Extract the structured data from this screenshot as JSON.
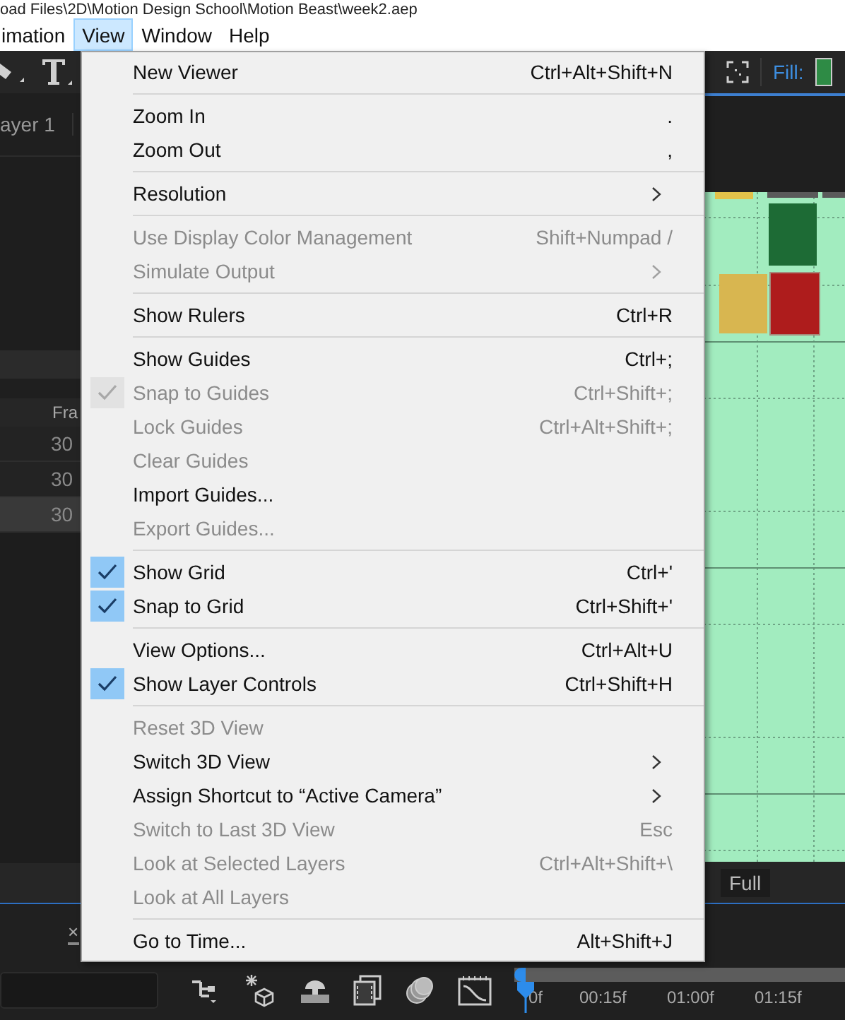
{
  "window": {
    "title": "oad Files\\2D\\Motion Design School\\Motion Beast\\week2.aep"
  },
  "menubar": [
    {
      "label": "imation",
      "selected": false
    },
    {
      "label": "View",
      "selected": true
    },
    {
      "label": "Window",
      "selected": false
    },
    {
      "label": "Help",
      "selected": false
    }
  ],
  "left_panel": {
    "tab": "ayer 1",
    "column_header": "Fra",
    "rows": [
      {
        "value": "30",
        "selected": false
      },
      {
        "value": "30",
        "selected": false
      },
      {
        "value": "30",
        "selected": true
      }
    ]
  },
  "viewer": {
    "fill_label": "Fill:",
    "resolution": "Full"
  },
  "timeline": {
    "close": "×",
    "ticks": [
      "0f",
      "00:15f",
      "01:00f",
      "01:15f"
    ]
  },
  "view_menu": {
    "groups": [
      [
        {
          "label": "New Viewer",
          "shortcut": "Ctrl+Alt+Shift+N",
          "disabled": false,
          "checked": false,
          "submenu": false
        }
      ],
      [
        {
          "label": "Zoom In",
          "shortcut": ".",
          "disabled": false,
          "checked": false,
          "submenu": false
        },
        {
          "label": "Zoom Out",
          "shortcut": ",",
          "disabled": false,
          "checked": false,
          "submenu": false
        }
      ],
      [
        {
          "label": "Resolution",
          "disabled": false,
          "checked": false,
          "submenu": true
        }
      ],
      [
        {
          "label": "Use Display Color Management",
          "shortcut": "Shift+Numpad /",
          "disabled": true,
          "checked": false,
          "submenu": false
        },
        {
          "label": "Simulate Output",
          "disabled": true,
          "checked": false,
          "submenu": true
        }
      ],
      [
        {
          "label": "Show Rulers",
          "shortcut": "Ctrl+R",
          "disabled": false,
          "checked": false,
          "submenu": false
        }
      ],
      [
        {
          "label": "Show Guides",
          "shortcut": "Ctrl+;",
          "disabled": false,
          "checked": false,
          "submenu": false
        },
        {
          "label": "Snap to Guides",
          "shortcut": "Ctrl+Shift+;",
          "disabled": true,
          "checked": true,
          "submenu": false
        },
        {
          "label": "Lock Guides",
          "shortcut": "Ctrl+Alt+Shift+;",
          "disabled": true,
          "checked": false,
          "submenu": false
        },
        {
          "label": "Clear Guides",
          "disabled": true,
          "checked": false,
          "submenu": false
        },
        {
          "label": "Import Guides...",
          "disabled": false,
          "checked": false,
          "submenu": false
        },
        {
          "label": "Export Guides...",
          "disabled": true,
          "checked": false,
          "submenu": false
        }
      ],
      [
        {
          "label": "Show Grid",
          "shortcut": "Ctrl+'",
          "disabled": false,
          "checked": true,
          "submenu": false
        },
        {
          "label": "Snap to Grid",
          "shortcut": "Ctrl+Shift+'",
          "disabled": false,
          "checked": true,
          "submenu": false
        }
      ],
      [
        {
          "label": "View Options...",
          "shortcut": "Ctrl+Alt+U",
          "disabled": false,
          "checked": false,
          "submenu": false
        },
        {
          "label": "Show Layer Controls",
          "shortcut": "Ctrl+Shift+H",
          "disabled": false,
          "checked": true,
          "submenu": false
        }
      ],
      [
        {
          "label": "Reset 3D View",
          "disabled": true,
          "checked": false,
          "submenu": false
        },
        {
          "label": "Switch 3D View",
          "disabled": false,
          "checked": false,
          "submenu": true
        },
        {
          "label": "Assign Shortcut to “Active Camera”",
          "disabled": false,
          "checked": false,
          "submenu": true
        },
        {
          "label": "Switch to Last 3D View",
          "shortcut": "Esc",
          "disabled": true,
          "checked": false,
          "submenu": false
        },
        {
          "label": "Look at Selected Layers",
          "shortcut": "Ctrl+Alt+Shift+\\",
          "disabled": true,
          "checked": false,
          "submenu": false
        },
        {
          "label": "Look at All Layers",
          "disabled": true,
          "checked": false,
          "submenu": false
        }
      ],
      [
        {
          "label": "Go to Time...",
          "shortcut": "Alt+Shift+J",
          "disabled": false,
          "checked": false,
          "submenu": false
        }
      ]
    ]
  }
}
